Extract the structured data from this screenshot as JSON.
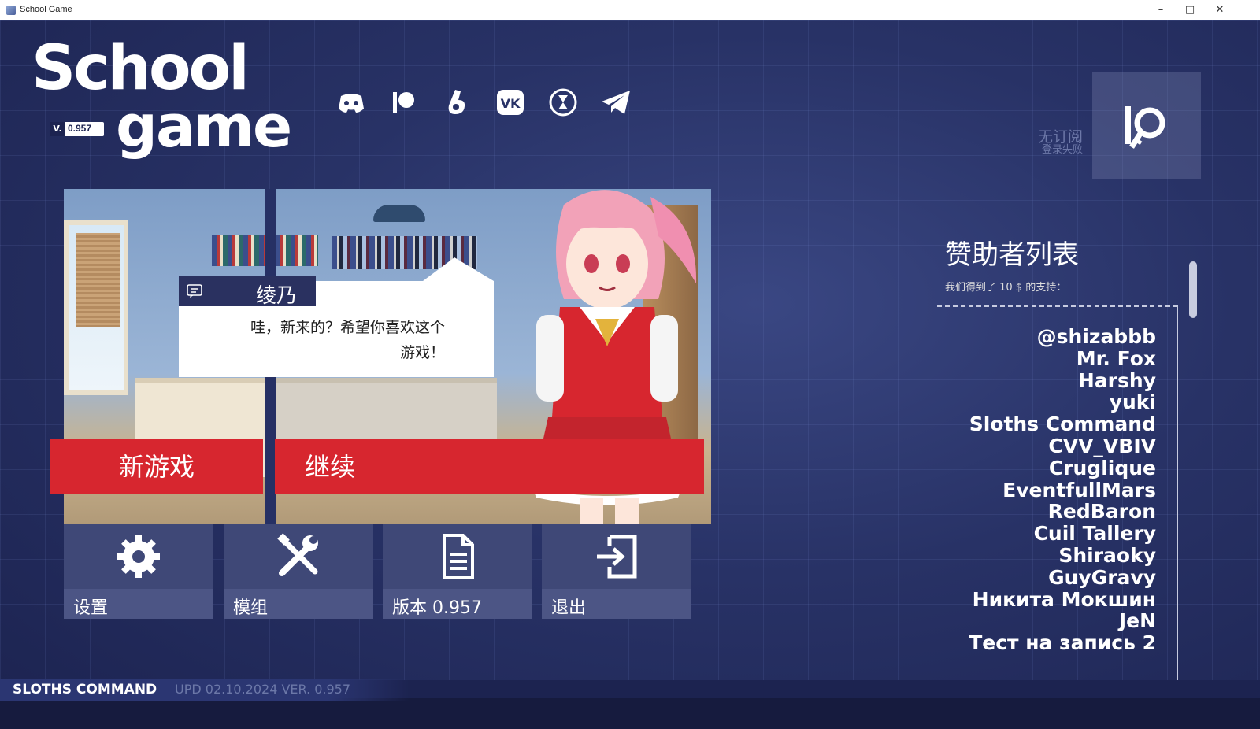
{
  "window": {
    "title": "School Game",
    "minimize": "–",
    "maximize": "□",
    "close": "✕"
  },
  "logo": {
    "line1": "School",
    "line2": "game",
    "version_prefix": "V.",
    "version": "0.957"
  },
  "social": [
    "discord-icon",
    "patreon-icon",
    "boosty-icon",
    "vk-icon",
    "subscribestar-icon",
    "telegram-icon"
  ],
  "subscription": {
    "status": "无订阅",
    "login_status": "登录失败"
  },
  "dialogue": {
    "speaker": "绫乃",
    "text_line1": "哇，新来的？希望你喜欢这个",
    "text_line2": "游戏！"
  },
  "buttons": {
    "new_game": "新游戏",
    "continue": "继续"
  },
  "tiles": [
    {
      "label": "设置",
      "icon": "gear-icon"
    },
    {
      "label": "模组",
      "icon": "tools-icon"
    },
    {
      "label": "版本 0.957",
      "icon": "document-icon"
    },
    {
      "label": "退出",
      "icon": "exit-icon"
    }
  ],
  "sponsors": {
    "title": "赞助者列表",
    "subtitle": "我们得到了 10 $ 的支持：",
    "names": [
      "@shizabbb",
      "Mr. Fox",
      "Harshy",
      "yuki",
      "Sloths Command",
      "CVV_VBIV",
      "Cruglique",
      "EventfullMars",
      "RedBaron",
      "Cuil Tallery",
      "Shiraoky",
      "GuyGravy",
      "Никита Мокшин",
      "JeN",
      "Тест на запись 2"
    ]
  },
  "footer": {
    "brand": "SLOTHS COMMAND",
    "update": "UPD 02.10.2024 VER. 0.957"
  },
  "colors": {
    "accent_red": "#d7262f",
    "panel": "#3f4877",
    "background": "#283266"
  }
}
